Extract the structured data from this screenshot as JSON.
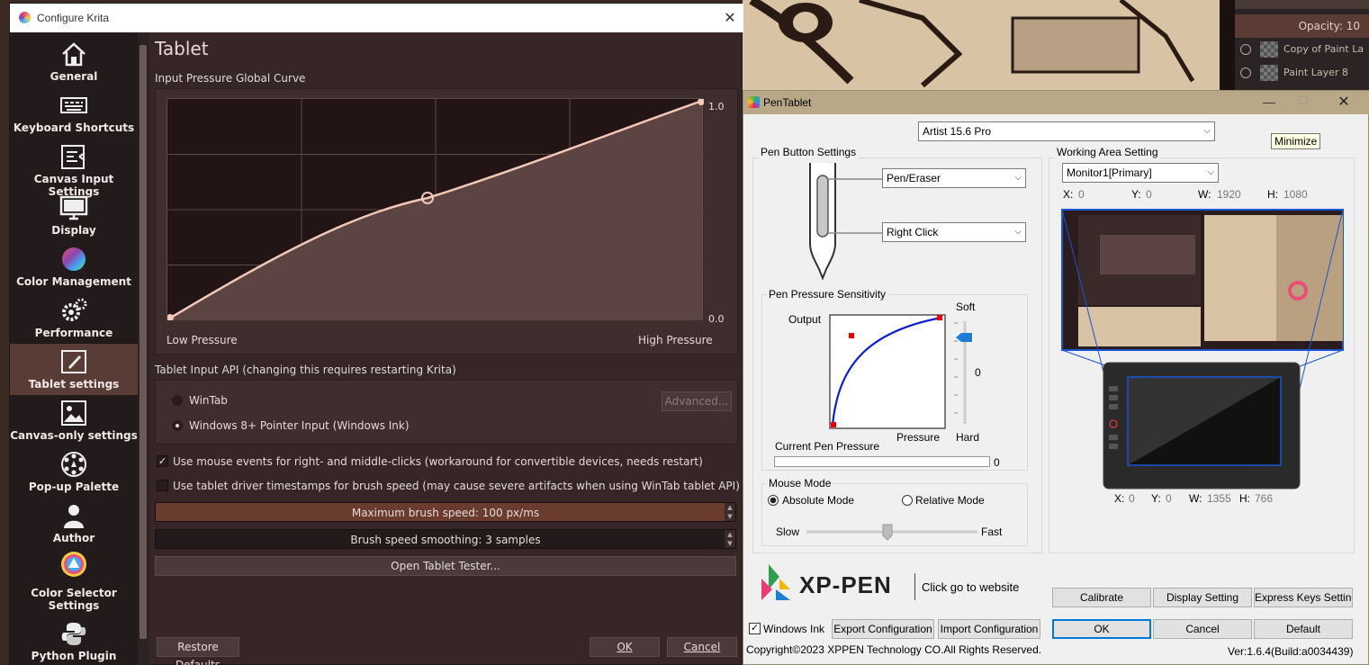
{
  "layers": {
    "opacity_label": "Opacity: 10",
    "items": [
      {
        "name": "Copy of Paint La"
      },
      {
        "name": "Paint Layer 8"
      }
    ]
  },
  "krita": {
    "window_title": "Configure Krita",
    "sidebar": [
      {
        "label": "General",
        "icon": "home-icon"
      },
      {
        "label": "Keyboard Shortcuts",
        "icon": "keyboard-icon"
      },
      {
        "label": "Canvas Input Settings",
        "icon": "canvas-input-icon"
      },
      {
        "label": "Display",
        "icon": "monitor-icon"
      },
      {
        "label": "Color Management",
        "icon": "color-wheel-icon"
      },
      {
        "label": "Performance",
        "icon": "gears-icon"
      },
      {
        "label": "Tablet settings",
        "icon": "tablet-pen-icon",
        "active": true
      },
      {
        "label": "Canvas-only settings",
        "icon": "image-icon"
      },
      {
        "label": "Pop-up Palette",
        "icon": "palette-icon"
      },
      {
        "label": "Author",
        "icon": "person-icon"
      },
      {
        "label": "Color Selector Settings",
        "icon": "color-selector-icon"
      },
      {
        "label": "Python Plugin",
        "icon": "python-icon"
      }
    ],
    "page_title": "Tablet",
    "curve_label": "Input Pressure Global Curve",
    "curve_top": "1.0",
    "curve_bottom": "0.0",
    "low_pressure": "Low Pressure",
    "high_pressure": "High Pressure",
    "api_label": "Tablet Input API (changing this requires restarting Krita)",
    "wintab": "WinTab",
    "advanced": "Advanced...",
    "pointer_input": "Windows 8+ Pointer Input (Windows Ink)",
    "mouse_events": "Use mouse events for right- and middle-clicks (workaround for convertible devices, needs restart)",
    "mouse_events_checked": true,
    "timestamps": "Use tablet driver timestamps for brush speed (may cause severe artifacts when using WinTab tablet API)",
    "timestamps_checked": false,
    "max_speed": "Maximum brush speed: 100 px/ms",
    "max_speed_level": 1.0,
    "smoothing": "Brush speed smoothing: 3 samples",
    "open_tester": "Open Tablet Tester...",
    "restore_defaults": "Restore Defaults",
    "ok": "OK",
    "cancel": "Cancel"
  },
  "pentablet": {
    "title": "PenTablet",
    "device": "Artist 15.6 Pro",
    "tooltip": "Minimize",
    "pen_button_settings": "Pen Button Settings",
    "button_upper": "Pen/Eraser",
    "button_lower": "Right Click",
    "pressure_sensitivity": "Pen Pressure Sensitivity",
    "output": "Output",
    "pressure": "Pressure",
    "soft": "Soft",
    "hard": "Hard",
    "sensitivity_value": "0",
    "current_pressure": "Current Pen Pressure",
    "current_pressure_value": "0",
    "mouse_mode": "Mouse Mode",
    "absolute_mode": "Absolute Mode",
    "relative_mode": "Relative Mode",
    "absolute_selected": true,
    "slow": "Slow",
    "fast": "Fast",
    "working_area": "Working Area Setting",
    "monitor": "Monitor1[Primary]",
    "mon_x_label": "X:",
    "mon_x": "0",
    "mon_y_label": "Y:",
    "mon_y": "0",
    "mon_w_label": "W:",
    "mon_w": "1920",
    "mon_h_label": "H:",
    "mon_h": "1080",
    "tab_x_label": "X:",
    "tab_x": "0",
    "tab_y_label": "Y:",
    "tab_y": "0",
    "tab_w_label": "W:",
    "tab_w": "1355",
    "tab_h_label": "H:",
    "tab_h": "766",
    "brand": "XP-PEN",
    "website": "Click go to website",
    "calibrate": "Calibrate",
    "display_setting": "Display Setting",
    "express_keys": "Express Keys Setting",
    "windows_ink": "Windows Ink",
    "windows_ink_checked": true,
    "export": "Export Configuration",
    "import": "Import Configuration",
    "ok": "OK",
    "cancel": "Cancel",
    "default": "Default",
    "copyright": "Copyright©2023  XPPEN Technology CO.All Rights Reserved.",
    "version": "Ver:1.6.4(Build:a0034439)"
  },
  "colors": {
    "accent": "#0078d7",
    "krita_bg": "#362628",
    "curve": "#f4c8b8",
    "active_item": "#5a3c36"
  }
}
